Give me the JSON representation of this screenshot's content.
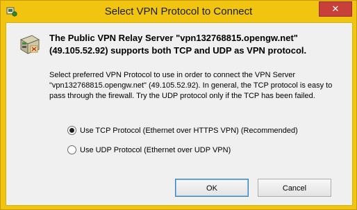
{
  "window": {
    "title": "Select VPN Protocol to Connect",
    "close_label": "✕"
  },
  "content": {
    "headline": "The Public VPN Relay Server \"vpn132768815.opengw.net\" (49.105.52.92) supports both TCP and UDP as VPN protocol.",
    "description": "Select preferred VPN Protocol to use in order to connect the VPN Server \"vpn132768815.opengw.net\" (49.105.52.92). In general, the TCP protocol is easy to pass through the firewall. Try the UDP protocol only if the TCP has been failed."
  },
  "options": [
    {
      "label": "Use TCP Protocol (Ethernet over HTTPS VPN) (Recommended)",
      "selected": true
    },
    {
      "label": "Use UDP Protocol (Ethernet over UDP VPN)",
      "selected": false
    }
  ],
  "buttons": {
    "ok": "OK",
    "cancel": "Cancel"
  },
  "colors": {
    "title_bar": "#f1c40f",
    "close_button": "#c7403a",
    "dialog_body": "#f0f0f0"
  },
  "icons": {
    "app": "vpn-client-icon",
    "server": "vpn-server-icon"
  }
}
